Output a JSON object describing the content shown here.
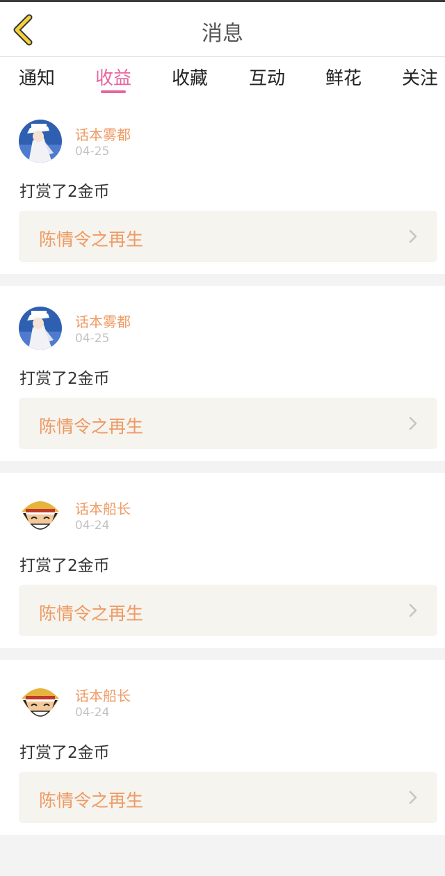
{
  "header": {
    "title": "消息",
    "back_icon": "chevron-left-icon",
    "accent": "#f5d23b"
  },
  "tabs": [
    {
      "label": "通知",
      "active": false
    },
    {
      "label": "收益",
      "active": true
    },
    {
      "label": "收藏",
      "active": false
    },
    {
      "label": "互动",
      "active": false
    },
    {
      "label": "鲜花",
      "active": false
    },
    {
      "label": "关注",
      "active": false
    }
  ],
  "colors": {
    "active_tab": "#e8659b",
    "username": "#ef9a63",
    "date": "#c2c2c2"
  },
  "messages": [
    {
      "user": "话本雾都",
      "date": "04-25",
      "action": "打赏了2金币",
      "work": "陈情令之再生",
      "avatar": "avatar-detective"
    },
    {
      "user": "话本雾都",
      "date": "04-25",
      "action": "打赏了2金币",
      "work": "陈情令之再生",
      "avatar": "avatar-detective"
    },
    {
      "user": "话本船长",
      "date": "04-24",
      "action": "打赏了2金币",
      "work": "陈情令之再生",
      "avatar": "avatar-straw-hat"
    },
    {
      "user": "话本船长",
      "date": "04-24",
      "action": "打赏了2金币",
      "work": "陈情令之再生",
      "avatar": "avatar-straw-hat"
    }
  ]
}
